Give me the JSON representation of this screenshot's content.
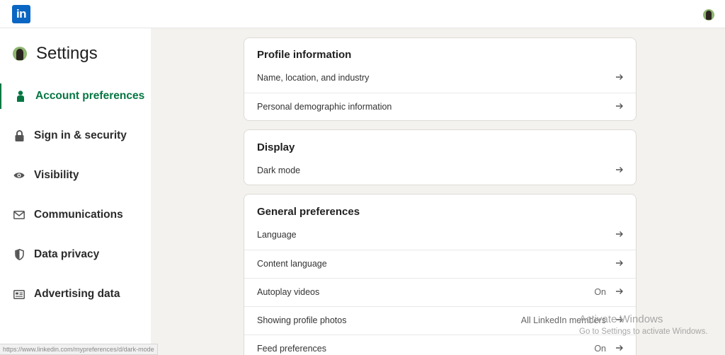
{
  "header": {
    "logo_text": "in",
    "brand_color": "#0a66c2"
  },
  "sidebar": {
    "title": "Settings",
    "items": [
      {
        "label": "Account preferences",
        "icon": "person-icon",
        "active": true
      },
      {
        "label": "Sign in & security",
        "icon": "lock-icon"
      },
      {
        "label": "Visibility",
        "icon": "eye-icon"
      },
      {
        "label": "Communications",
        "icon": "envelope-icon"
      },
      {
        "label": "Data privacy",
        "icon": "shield-icon"
      },
      {
        "label": "Advertising data",
        "icon": "newspaper-icon"
      }
    ],
    "active_color": "#057642"
  },
  "cards": {
    "profile": {
      "title": "Profile information",
      "rows": [
        {
          "label": "Name, location, and industry"
        },
        {
          "label": "Personal demographic information"
        }
      ]
    },
    "display": {
      "title": "Display",
      "rows": [
        {
          "label": "Dark mode"
        }
      ]
    },
    "general": {
      "title": "General preferences",
      "rows": [
        {
          "label": "Language"
        },
        {
          "label": "Content language"
        },
        {
          "label": "Autoplay videos",
          "value": "On"
        },
        {
          "label": "Showing profile photos",
          "value": "All LinkedIn members"
        },
        {
          "label": "Feed preferences",
          "value": "On"
        }
      ]
    }
  },
  "watermark": {
    "line1": "Activate Windows",
    "line2": "Go to Settings to activate Windows."
  },
  "status_url": "https://www.linkedin.com/mypreferences/d/dark-mode"
}
